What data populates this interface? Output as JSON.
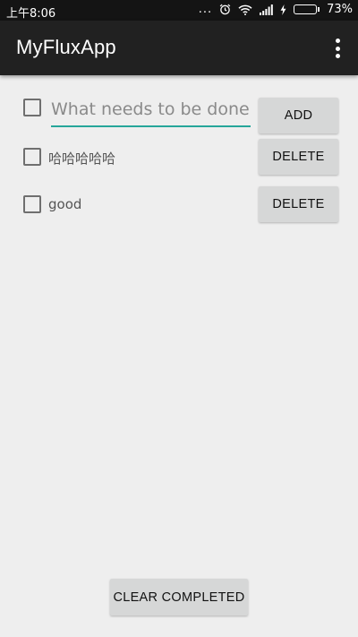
{
  "status_bar": {
    "time": "上午8:06",
    "dots": "...",
    "battery_percent": "73%",
    "battery_level": 0.73,
    "icons": [
      "alarm-icon",
      "wifi-icon",
      "signal-icon",
      "charging-icon",
      "battery-icon"
    ]
  },
  "app_bar": {
    "title": "MyFluxApp",
    "menu_icon": "overflow-menu-icon"
  },
  "new_todo": {
    "placeholder": "What needs to be done?",
    "value": "",
    "add_label": "ADD"
  },
  "todos": [
    {
      "text": "哈哈哈哈哈",
      "completed": false,
      "delete_label": "DELETE"
    },
    {
      "text": "good",
      "completed": false,
      "delete_label": "DELETE"
    }
  ],
  "footer": {
    "clear_label": "CLEAR COMPLETED"
  },
  "colors": {
    "accent": "#26a69a",
    "app_bar": "#212121",
    "status_bar": "#141414",
    "background": "#eeeeee",
    "button": "#d6d7d7",
    "battery": "#4cd964"
  }
}
